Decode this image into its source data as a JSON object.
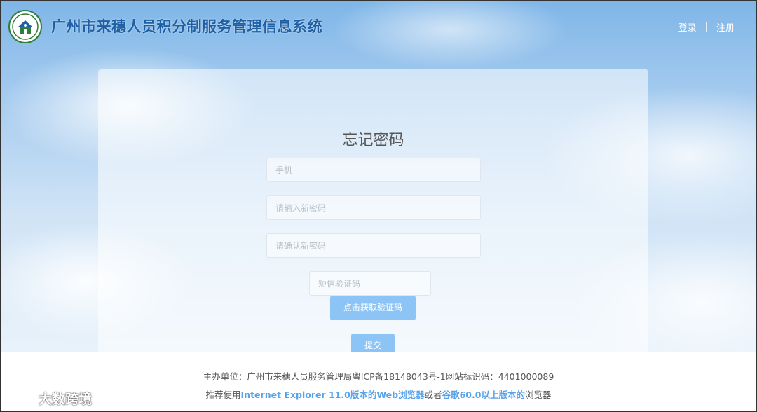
{
  "header": {
    "title": "广州市来穗人员积分制服务管理信息系统",
    "login": "登录",
    "separator": "|",
    "register": "注册"
  },
  "form": {
    "title": "忘记密码",
    "phone_placeholder": "手机",
    "new_password_placeholder": "请输入新密码",
    "confirm_password_placeholder": "请确认新密码",
    "sms_placeholder": "短信验证码",
    "get_code_label": "点击获取验证码",
    "submit_label": "提交"
  },
  "footer": {
    "line1": "主办单位：广州市来穗人员服务管理局粤ICP备18148043号-1网站标识码：4401000089",
    "line2_pre": "推荐使用",
    "line2_ie": "Internet Explorer 11.0版本的Web浏览器",
    "line2_mid": "或者",
    "line2_chrome": "谷歌60.0以上版本的",
    "line2_post": "浏览器"
  },
  "watermark": {
    "text": "大数跨境"
  },
  "colors": {
    "title_blue": "#1f5fa3",
    "button_blue": "#8cc4f6",
    "link_blue": "#5aa2e8"
  }
}
